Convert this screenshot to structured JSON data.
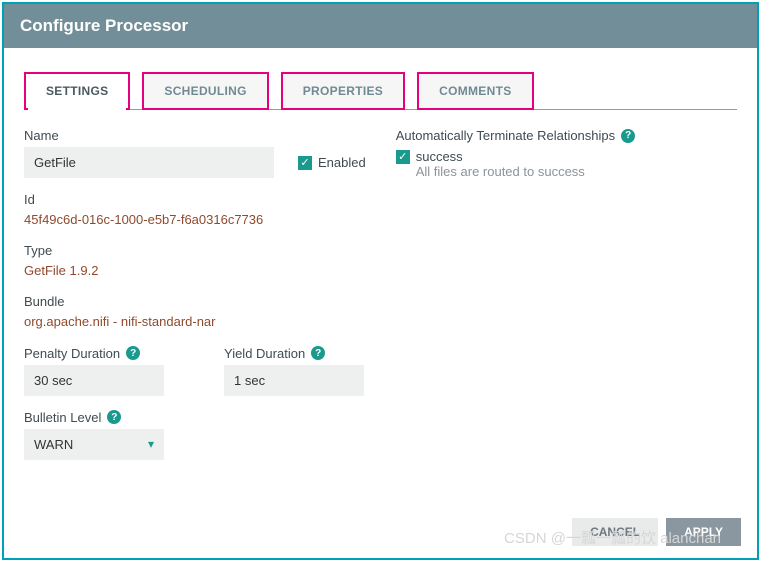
{
  "dialog": {
    "title": "Configure Processor"
  },
  "tabs": {
    "settings": "SETTINGS",
    "scheduling": "SCHEDULING",
    "properties": "PROPERTIES",
    "comments": "COMMENTS"
  },
  "settings": {
    "name_label": "Name",
    "name_value": "GetFile",
    "enabled_label": "Enabled",
    "id_label": "Id",
    "id_value": "45f49c6d-016c-1000-e5b7-f6a0316c7736",
    "type_label": "Type",
    "type_value": "GetFile 1.9.2",
    "bundle_label": "Bundle",
    "bundle_value": "org.apache.nifi - nifi-standard-nar",
    "penalty_label": "Penalty Duration",
    "penalty_value": "30 sec",
    "yield_label": "Yield Duration",
    "yield_value": "1 sec",
    "bulletin_label": "Bulletin Level",
    "bulletin_value": "WARN"
  },
  "relationships": {
    "header": "Automatically Terminate Relationships",
    "success_label": "success",
    "success_desc": "All files are routed to success"
  },
  "buttons": {
    "cancel": "CANCEL",
    "apply": "APPLY"
  },
  "watermark": "CSDN @一瓢一瓢的饮 alanchan"
}
